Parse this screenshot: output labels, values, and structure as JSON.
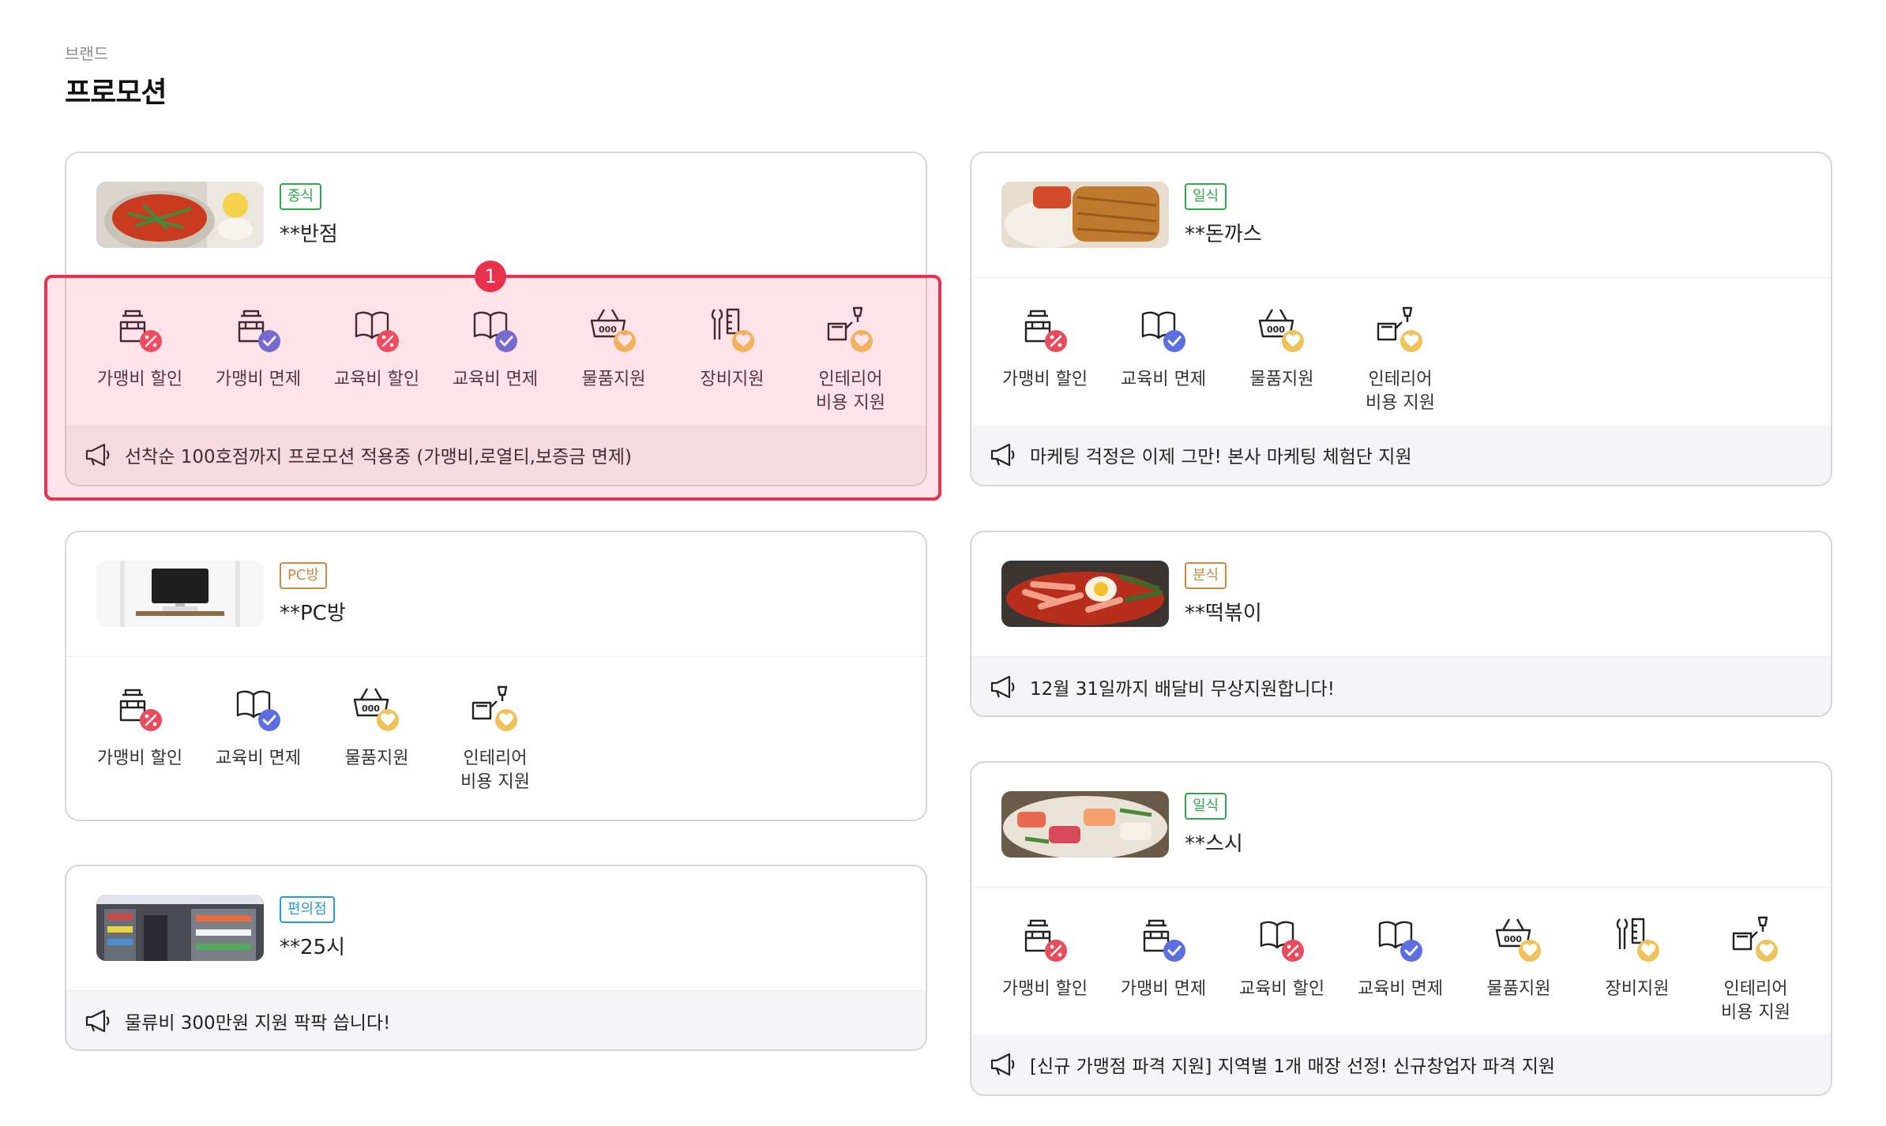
{
  "header": {
    "breadcrumb": "브랜드",
    "title": "프로모션"
  },
  "colors": {
    "accent": "#e9314d",
    "discount": "#ea4b5a",
    "exempt": "#5b6fe0",
    "support": "#f0c35a"
  },
  "benefit_labels": {
    "franchise_discount": "가맹비 할인",
    "franchise_exempt": "가맹비 면제",
    "education_discount": "교육비 할인",
    "education_exempt": "교육비 면제",
    "goods_support": "물품지원",
    "equipment_support": "장비지원",
    "interior_support": "인테리어\n비용 지원"
  },
  "cards": [
    {
      "category": "중식",
      "name": "**반점",
      "notice": "선착순 100호점까지 프로모션 적용중 (가맹비,로열티,보증금 면제)"
    },
    {
      "category": "일식",
      "name": "**돈까스",
      "notice": "마케팅 걱정은 이제 그만! 본사 마케팅 체험단 지원"
    },
    {
      "category": "PC방",
      "name": "**PC방"
    },
    {
      "category": "분식",
      "name": "**떡볶이",
      "notice": "12월 31일까지 배달비 무상지원합니다!"
    },
    {
      "category": "편의점",
      "name": "**25시",
      "notice": "물류비 300만원 지원 팍팍 씁니다!"
    },
    {
      "category": "일식",
      "name": "**스시",
      "notice": "[신규 가맹점 파격 지원] 지역별 1개 매장 선정! 신규창업자 파격 지원"
    }
  ],
  "annotation": {
    "badge": "1"
  }
}
